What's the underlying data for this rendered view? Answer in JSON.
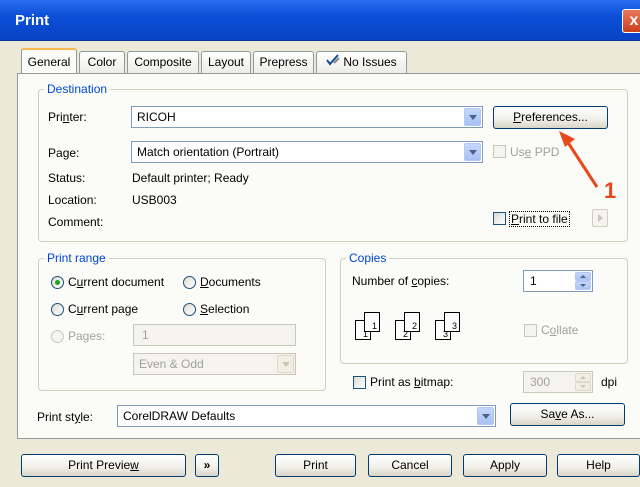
{
  "window": {
    "title": "Print",
    "close_label": "x"
  },
  "tabs": [
    {
      "label": "General",
      "active": true
    },
    {
      "label": "Color"
    },
    {
      "label": "Composite"
    },
    {
      "label": "Layout"
    },
    {
      "label": "Prepress"
    },
    {
      "label": "No Issues"
    }
  ],
  "destination": {
    "group_label": "Destination",
    "printer_label": "Printer:",
    "printer_value": "RICOH",
    "preferences_button": "Preferences...",
    "page_label": "Page:",
    "page_value": "Match orientation (Portrait)",
    "use_ppd_label": "Use PPD",
    "status_label": "Status:",
    "status_value": "Default printer; Ready",
    "location_label": "Location:",
    "location_value": "USB003",
    "comment_label": "Comment:",
    "print_to_file_label": "Print to file"
  },
  "annotation": {
    "number": "1",
    "color": "#e8481c"
  },
  "print_range": {
    "group_label": "Print range",
    "current_document": "Current document",
    "documents": "Documents",
    "current_page": "Current page",
    "selection": "Selection",
    "pages_label": "Pages:",
    "pages_value": "1",
    "even_odd_value": "Even & Odd"
  },
  "copies": {
    "group_label": "Copies",
    "number_label": "Number of copies:",
    "number_value": "1",
    "collate_label": "Collate",
    "icon_pages": [
      "1",
      "1",
      "2",
      "2",
      "3",
      "3"
    ]
  },
  "bitmap": {
    "label": "Print as bitmap:",
    "dpi_value": "300",
    "dpi_unit": "dpi"
  },
  "print_style": {
    "label": "Print style:",
    "value": "CorelDRAW Defaults",
    "save_as_button": "Save As..."
  },
  "footer": {
    "print_preview": "Print Preview",
    "preview_arrow": "»",
    "print": "Print",
    "cancel": "Cancel",
    "apply": "Apply",
    "help": "Help"
  }
}
